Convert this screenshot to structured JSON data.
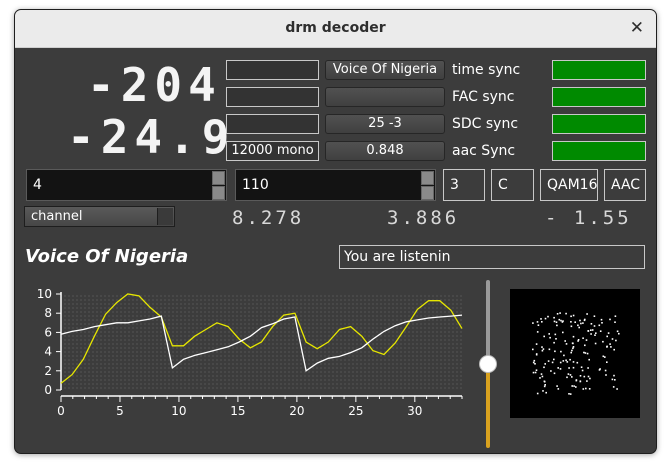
{
  "window": {
    "title": "drm decoder",
    "close_label": "✕"
  },
  "lcd": {
    "top": "-204",
    "bottom": "-24.9"
  },
  "lcd_small": {
    "a": "8.278",
    "b": "3.886",
    "c": "- 1.55"
  },
  "left_boxes": [
    "",
    "",
    "",
    "12000 mono"
  ],
  "buttons": [
    "Voice Of Nigeria",
    "",
    "25  -3",
    "0.848"
  ],
  "sync_labels": [
    "time sync",
    "FAC sync",
    "SDC sync",
    "aac Sync"
  ],
  "led_color": "#008a00",
  "spin1": {
    "value": "4"
  },
  "spin2": {
    "value": "110"
  },
  "value_boxes": [
    "3",
    "C",
    "QAM16",
    "AAC"
  ],
  "combo": {
    "value": "channel"
  },
  "station_name": "Voice Of Nigeria",
  "message": {
    "value": "You are listenin"
  },
  "slider": {
    "level": 0.5
  },
  "chart_data": {
    "type": "line",
    "x_ticks": [
      "0",
      "5",
      "10",
      "15",
      "20",
      "25",
      "30"
    ],
    "y_ticks": [
      "0",
      "2",
      "4",
      "6",
      "8",
      "10"
    ],
    "xlim": [
      0,
      34
    ],
    "ylim": [
      0,
      10
    ],
    "grid": true,
    "series": [
      {
        "color": "#e6e600",
        "values": [
          0.7,
          1.6,
          3.2,
          5.6,
          7.9,
          9.1,
          10.0,
          9.8,
          8.6,
          7.6,
          4.6,
          4.6,
          5.6,
          6.3,
          7.0,
          6.6,
          5.3,
          4.4,
          5.0,
          6.6,
          7.8,
          8.0,
          5.0,
          4.3,
          5.0,
          6.3,
          6.6,
          5.6,
          4.1,
          3.7,
          4.9,
          6.6,
          8.4,
          9.3,
          9.3,
          8.3,
          6.4
        ]
      },
      {
        "color": "#ffffff",
        "values": [
          5.8,
          6.1,
          6.3,
          6.6,
          6.8,
          7.0,
          7.0,
          7.2,
          7.4,
          7.7,
          2.3,
          3.2,
          3.6,
          3.9,
          4.2,
          4.5,
          5.0,
          5.6,
          6.5,
          6.9,
          7.4,
          7.6,
          2.0,
          2.8,
          3.3,
          3.5,
          3.9,
          4.4,
          5.3,
          6.1,
          6.7,
          7.1,
          7.3,
          7.5,
          7.6,
          7.7,
          7.8
        ]
      }
    ]
  }
}
